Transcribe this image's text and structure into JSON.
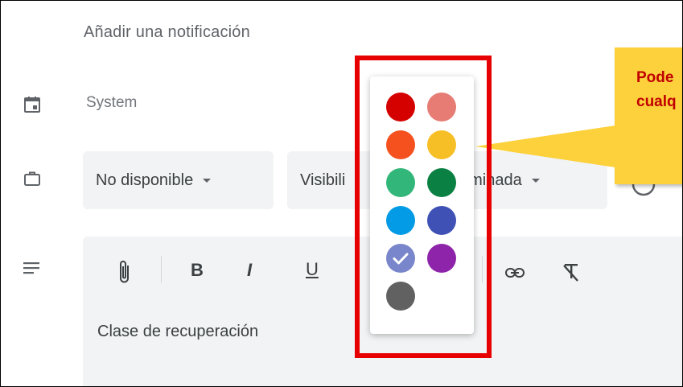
{
  "notification": {
    "add_label": "Añadir una notificación"
  },
  "calendar": {
    "icon": "calendar-icon",
    "value": "System"
  },
  "availability": {
    "icon": "briefcase-icon",
    "value": "No disponible",
    "visibility_left": "Visibili",
    "visibility_right": "erminada"
  },
  "description": {
    "icon": "notes-icon",
    "toolbar": {
      "attach_icon": "attach-icon",
      "bold_label": "B",
      "italic_label": "I",
      "underline_label": "U",
      "link_icon": "link-icon",
      "clear_format_icon": "clear-format-icon"
    },
    "text": "Clase de recuperación"
  },
  "color_picker": {
    "selected_index": 8,
    "colors": [
      "#d50000",
      "#e67c73",
      "#f4511e",
      "#f6bf26",
      "#33b679",
      "#0b8043",
      "#039be5",
      "#3f51b5",
      "#7986cb",
      "#8e24aa",
      "#616161"
    ]
  },
  "callout": {
    "line1": "Pode",
    "line2": "cualq"
  },
  "colors": {
    "highlight": "#e60000",
    "callout_bg": "#fcd13b",
    "callout_text": "#c00000"
  }
}
